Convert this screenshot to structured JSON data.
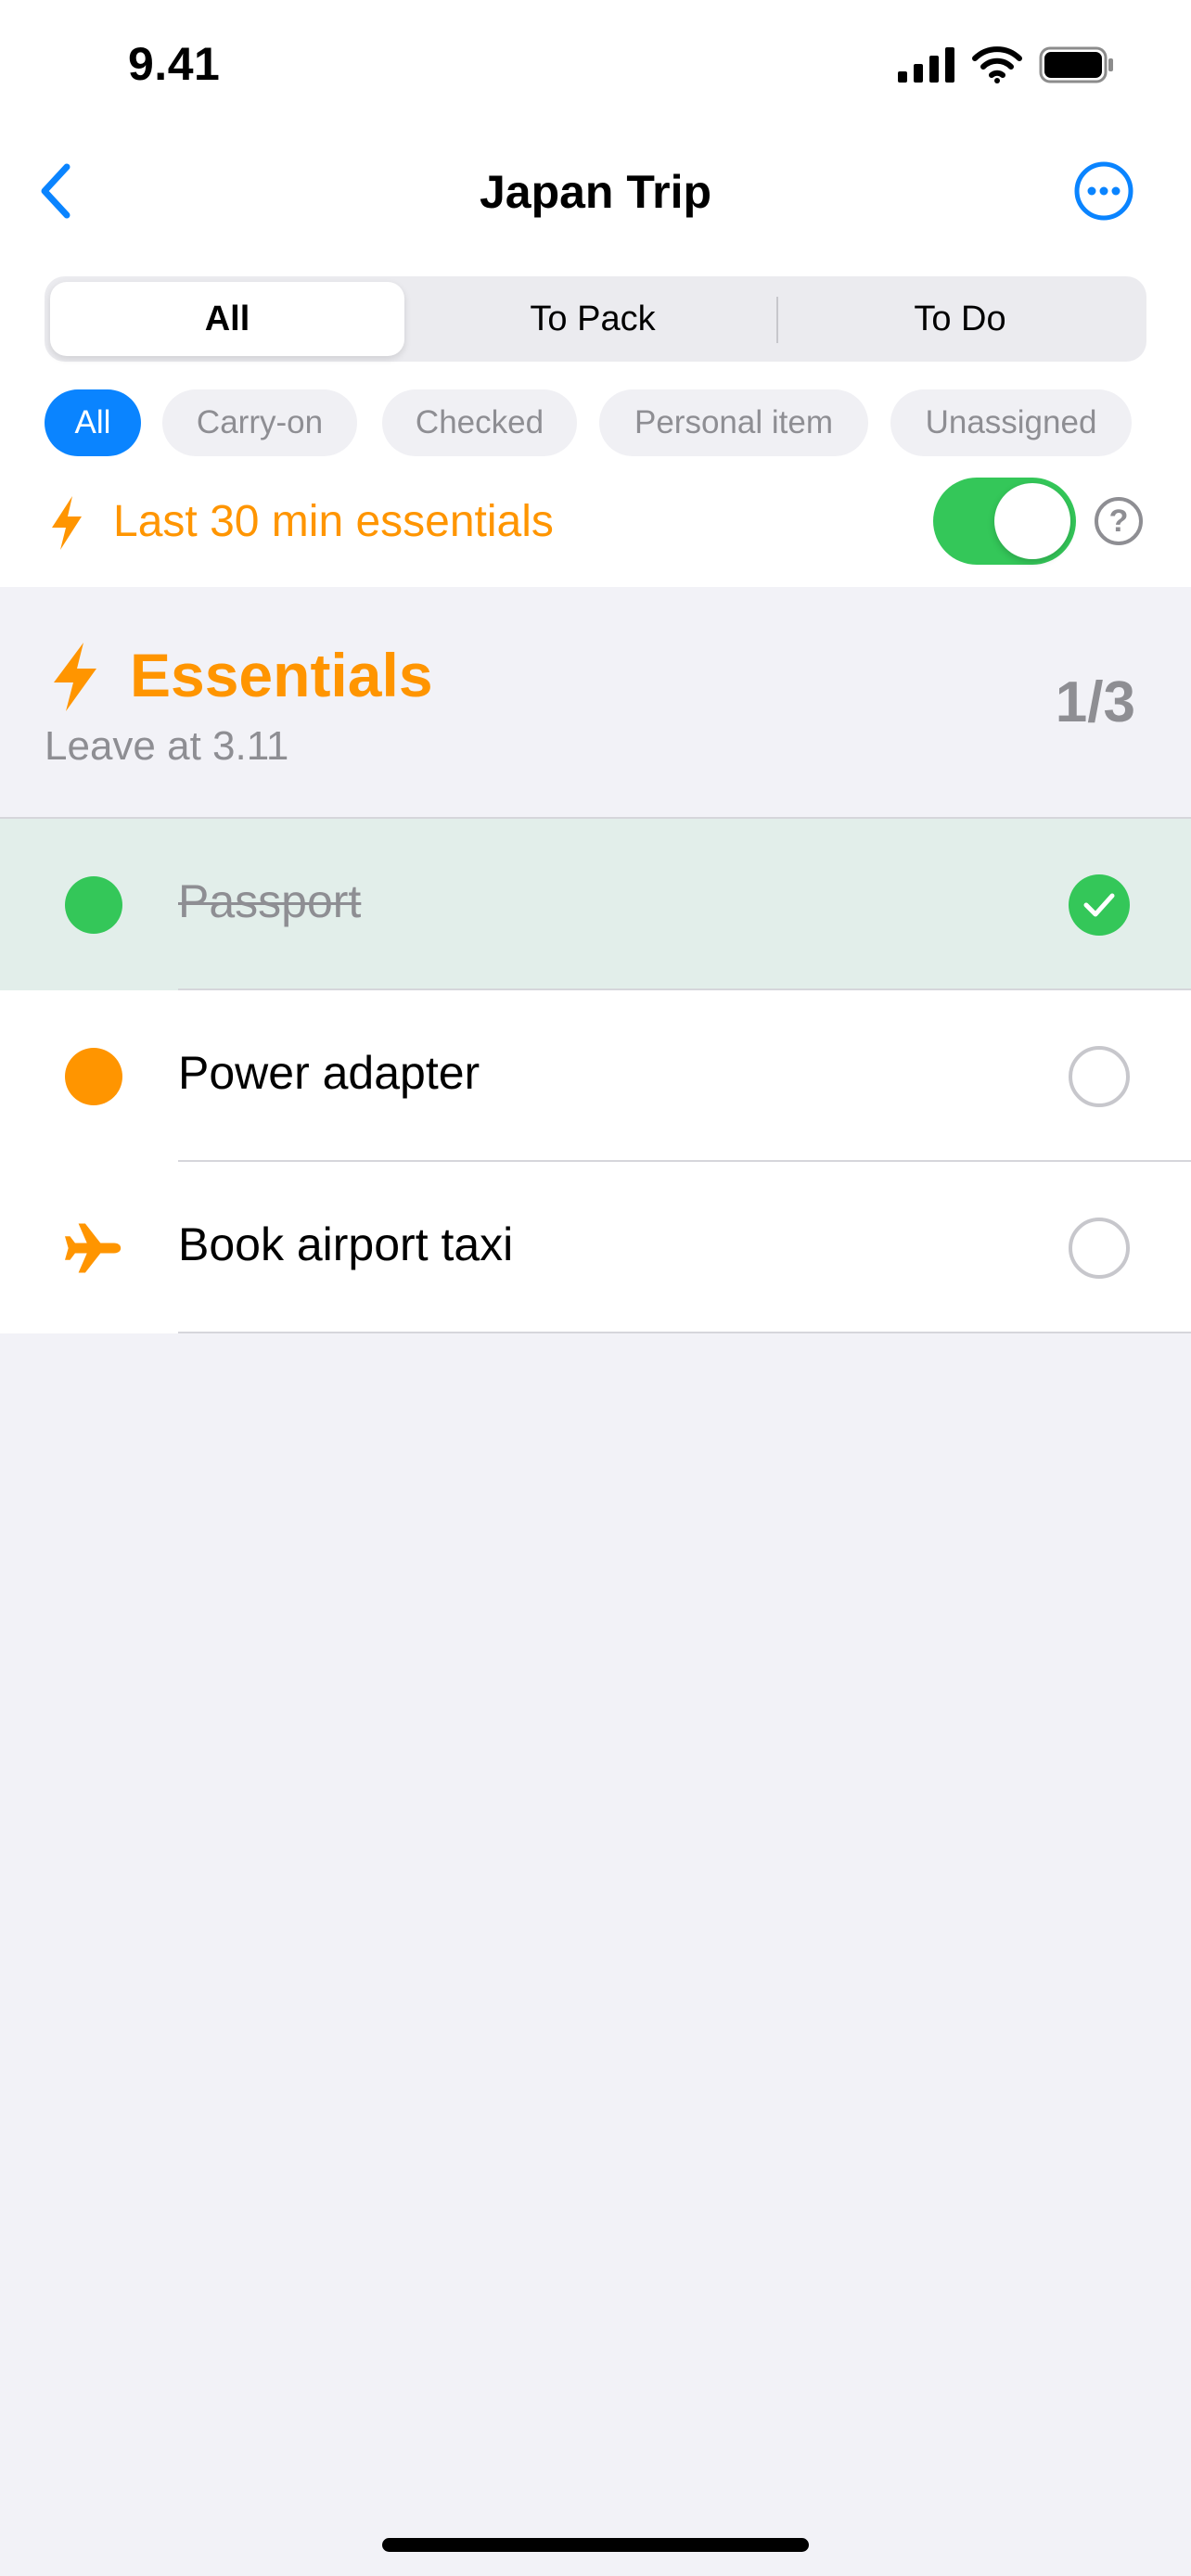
{
  "status_bar": {
    "time": "9.41"
  },
  "nav": {
    "title": "Japan Trip"
  },
  "segments": [
    {
      "label": "All",
      "active": true
    },
    {
      "label": "To Pack",
      "active": false
    },
    {
      "label": "To Do",
      "active": false
    }
  ],
  "chips": [
    {
      "label": "All",
      "active": true
    },
    {
      "label": "Carry-on",
      "active": false
    },
    {
      "label": "Checked",
      "active": false
    },
    {
      "label": "Personal item",
      "active": false
    },
    {
      "label": "Unassigned",
      "active": false
    }
  ],
  "essentials_toggle": {
    "label": "Last 30 min essentials",
    "on": true,
    "help_glyph": "?"
  },
  "section": {
    "title": "Essentials",
    "subtitle": "Leave at 3.11",
    "count": "1/3",
    "icon": "bolt-icon"
  },
  "items": [
    {
      "label": "Passport",
      "done": true,
      "icon": "dot",
      "color": "#34C759"
    },
    {
      "label": "Power adapter",
      "done": false,
      "icon": "dot",
      "color": "#FF9500"
    },
    {
      "label": "Book airport taxi",
      "done": false,
      "icon": "airplane-icon",
      "color": "#FF9500"
    }
  ],
  "colors": {
    "accent": "#0A84FF",
    "essentials": "#FF9500",
    "success": "#34C759",
    "secondary_text": "#8E8E93",
    "background": "#F2F2F7"
  }
}
